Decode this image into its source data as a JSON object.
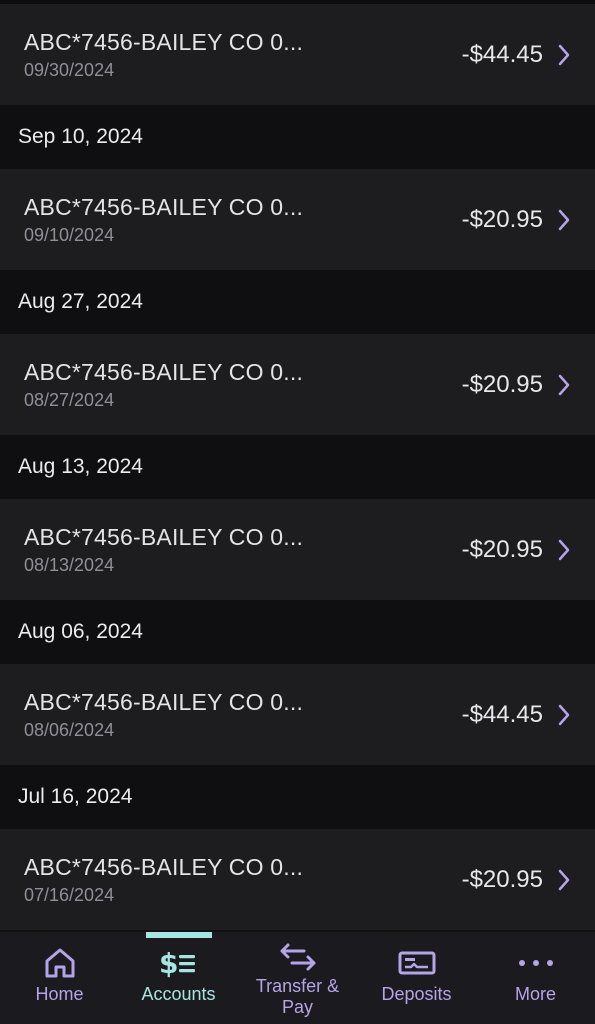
{
  "colors": {
    "background": "#111113",
    "row": "#1d1d20",
    "accent_purple": "#b4a4e8",
    "accent_teal": "#a6e6e2"
  },
  "transactions_top": {
    "name": "ABC*7456-BAILEY CO 0...",
    "date": "09/30/2024",
    "amount": "-$44.45"
  },
  "groups": [
    {
      "header": "Sep 10, 2024",
      "name": "ABC*7456-BAILEY CO 0...",
      "date": "09/10/2024",
      "amount": "-$20.95"
    },
    {
      "header": "Aug 27, 2024",
      "name": "ABC*7456-BAILEY CO 0...",
      "date": "08/27/2024",
      "amount": "-$20.95"
    },
    {
      "header": "Aug 13, 2024",
      "name": "ABC*7456-BAILEY CO 0...",
      "date": "08/13/2024",
      "amount": "-$20.95"
    },
    {
      "header": "Aug 06, 2024",
      "name": "ABC*7456-BAILEY CO 0...",
      "date": "08/06/2024",
      "amount": "-$44.45"
    },
    {
      "header": "Jul 16, 2024",
      "name": "ABC*7456-BAILEY CO 0...",
      "date": "07/16/2024",
      "amount": "-$20.95"
    }
  ],
  "nav": {
    "items": [
      {
        "label": "Home",
        "icon": "home-icon",
        "active": false
      },
      {
        "label": "Accounts",
        "icon": "accounts-icon",
        "active": true
      },
      {
        "label": "Transfer &\nPay",
        "icon": "transfer-icon",
        "active": false
      },
      {
        "label": "Deposits",
        "icon": "deposit-check-icon",
        "active": false
      },
      {
        "label": "More",
        "icon": "more-icon",
        "active": false
      }
    ]
  }
}
